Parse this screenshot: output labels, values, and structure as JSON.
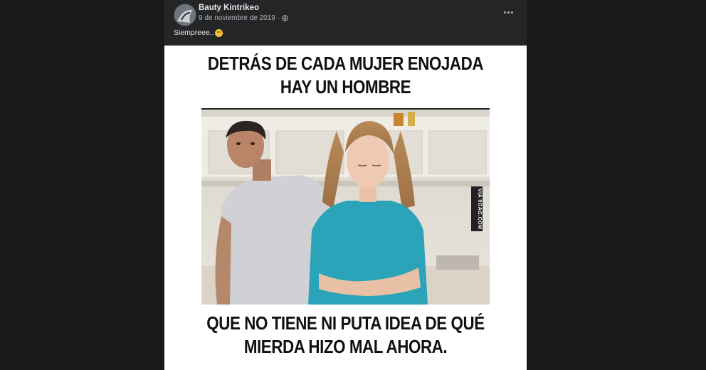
{
  "post": {
    "author": "Bauty Kintrikeo",
    "date": "9 de noviembre de 2019",
    "separator": "·",
    "audience_icon": "globe-icon",
    "caption": "Siempreee..",
    "caption_emoji": "smiling-face-icon",
    "more_icon": "more-options-icon"
  },
  "meme": {
    "top_line_1": "DETRÁS DE CADA MUJER ENOJADA",
    "top_line_2": "HAY UN HOMBRE",
    "bottom_line_1": "QUE NO TIENE NI PUTA IDEA DE QUÉ",
    "bottom_line_2": "MIERDA HIZO MAL AHORA.",
    "watermark": "VIA 9GAG.COM"
  },
  "colors": {
    "page_bg": "#18191a",
    "card_bg": "#242526",
    "primary_text": "#e4e6eb",
    "secondary_text": "#b0b3b8"
  }
}
